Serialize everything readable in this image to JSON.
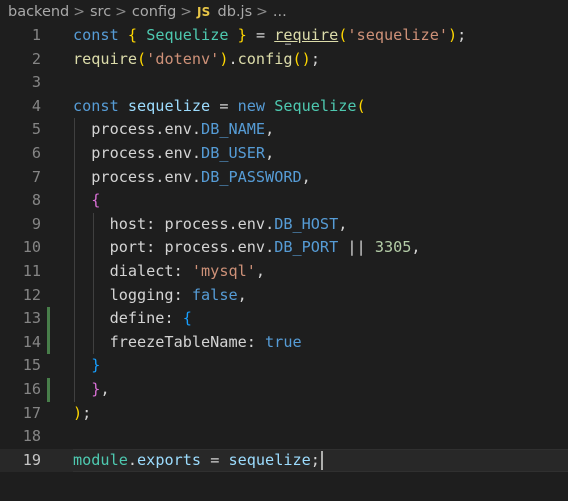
{
  "breadcrumb": {
    "segments": [
      "backend",
      "src",
      "config"
    ],
    "file_badge": "JS",
    "file_name": "db.js",
    "ellipsis": "...",
    "separator": ">"
  },
  "editor": {
    "current_line": 19,
    "lines": [
      {
        "number": "1",
        "tokens": [
          {
            "t": "const",
            "c": "kw"
          },
          {
            "t": " ",
            "c": "txt"
          },
          {
            "t": "{",
            "c": "b1"
          },
          {
            "t": " ",
            "c": "txt"
          },
          {
            "t": "Sequelize",
            "c": "cls"
          },
          {
            "t": " ",
            "c": "txt"
          },
          {
            "t": "}",
            "c": "b1"
          },
          {
            "t": " = ",
            "c": "txt"
          },
          {
            "t": "require",
            "c": "fn"
          },
          {
            "t": "(",
            "c": "b1"
          },
          {
            "t": "'sequelize'",
            "c": "str"
          },
          {
            "t": ")",
            "c": "b1"
          },
          {
            "t": ";",
            "c": "txt"
          }
        ]
      },
      {
        "number": "2",
        "tokens": [
          {
            "t": "require",
            "c": "fn"
          },
          {
            "t": "(",
            "c": "b1"
          },
          {
            "t": "'dotenv'",
            "c": "str"
          },
          {
            "t": ")",
            "c": "b1"
          },
          {
            "t": ".",
            "c": "txt"
          },
          {
            "t": "config",
            "c": "fn"
          },
          {
            "t": "()",
            "c": "b1"
          },
          {
            "t": ";",
            "c": "txt"
          }
        ]
      },
      {
        "number": "3",
        "tokens": []
      },
      {
        "number": "4",
        "tokens": [
          {
            "t": "const",
            "c": "kw"
          },
          {
            "t": " ",
            "c": "txt"
          },
          {
            "t": "sequelize",
            "c": "var"
          },
          {
            "t": " = ",
            "c": "txt"
          },
          {
            "t": "new",
            "c": "kw"
          },
          {
            "t": " ",
            "c": "txt"
          },
          {
            "t": "Sequelize",
            "c": "cls"
          },
          {
            "t": "(",
            "c": "b1"
          }
        ]
      },
      {
        "number": "5",
        "tokens": [
          {
            "t": "  process",
            "c": "txt"
          },
          {
            "t": ".",
            "c": "txt"
          },
          {
            "t": "env",
            "c": "txt"
          },
          {
            "t": ".",
            "c": "txt"
          },
          {
            "t": "DB_NAME",
            "c": "kw"
          },
          {
            "t": ",",
            "c": "txt"
          }
        ]
      },
      {
        "number": "6",
        "tokens": [
          {
            "t": "  process",
            "c": "txt"
          },
          {
            "t": ".",
            "c": "txt"
          },
          {
            "t": "env",
            "c": "txt"
          },
          {
            "t": ".",
            "c": "txt"
          },
          {
            "t": "DB_USER",
            "c": "kw"
          },
          {
            "t": ",",
            "c": "txt"
          }
        ]
      },
      {
        "number": "7",
        "tokens": [
          {
            "t": "  process",
            "c": "txt"
          },
          {
            "t": ".",
            "c": "txt"
          },
          {
            "t": "env",
            "c": "txt"
          },
          {
            "t": ".",
            "c": "txt"
          },
          {
            "t": "DB_PASSWORD",
            "c": "kw"
          },
          {
            "t": ",",
            "c": "txt"
          }
        ]
      },
      {
        "number": "8",
        "tokens": [
          {
            "t": "  ",
            "c": "txt"
          },
          {
            "t": "{",
            "c": "b2"
          }
        ]
      },
      {
        "number": "9",
        "tokens": [
          {
            "t": "    host",
            "c": "txt"
          },
          {
            "t": ": ",
            "c": "txt"
          },
          {
            "t": "process",
            "c": "txt"
          },
          {
            "t": ".",
            "c": "txt"
          },
          {
            "t": "env",
            "c": "txt"
          },
          {
            "t": ".",
            "c": "txt"
          },
          {
            "t": "DB_HOST",
            "c": "kw"
          },
          {
            "t": ",",
            "c": "txt"
          }
        ]
      },
      {
        "number": "10",
        "tokens": [
          {
            "t": "    port",
            "c": "txt"
          },
          {
            "t": ": ",
            "c": "txt"
          },
          {
            "t": "process",
            "c": "txt"
          },
          {
            "t": ".",
            "c": "txt"
          },
          {
            "t": "env",
            "c": "txt"
          },
          {
            "t": ".",
            "c": "txt"
          },
          {
            "t": "DB_PORT",
            "c": "kw"
          },
          {
            "t": " || ",
            "c": "txt"
          },
          {
            "t": "3305",
            "c": "num"
          },
          {
            "t": ",",
            "c": "txt"
          }
        ]
      },
      {
        "number": "11",
        "tokens": [
          {
            "t": "    dialect",
            "c": "txt"
          },
          {
            "t": ": ",
            "c": "txt"
          },
          {
            "t": "'mysql'",
            "c": "str"
          },
          {
            "t": ",",
            "c": "txt"
          }
        ]
      },
      {
        "number": "12",
        "tokens": [
          {
            "t": "    logging",
            "c": "txt"
          },
          {
            "t": ": ",
            "c": "txt"
          },
          {
            "t": "false",
            "c": "kw"
          },
          {
            "t": ",",
            "c": "txt"
          }
        ]
      },
      {
        "number": "13",
        "tokens": [
          {
            "t": "    define",
            "c": "txt"
          },
          {
            "t": ": ",
            "c": "txt"
          },
          {
            "t": "{",
            "c": "b3"
          }
        ]
      },
      {
        "number": "14",
        "tokens": [
          {
            "t": "    freezeTableName",
            "c": "txt"
          },
          {
            "t": ": ",
            "c": "txt"
          },
          {
            "t": "true",
            "c": "kw"
          }
        ]
      },
      {
        "number": "15",
        "tokens": [
          {
            "t": "  ",
            "c": "txt"
          },
          {
            "t": "}",
            "c": "b3"
          }
        ]
      },
      {
        "number": "16",
        "tokens": [
          {
            "t": "  ",
            "c": "txt"
          },
          {
            "t": "}",
            "c": "b2"
          },
          {
            "t": ",",
            "c": "txt"
          }
        ]
      },
      {
        "number": "17",
        "tokens": [
          {
            "t": ")",
            "c": "b1"
          },
          {
            "t": ";",
            "c": "txt"
          }
        ]
      },
      {
        "number": "18",
        "tokens": []
      },
      {
        "number": "19",
        "tokens": [
          {
            "t": "module",
            "c": "cls"
          },
          {
            "t": ".",
            "c": "txt"
          },
          {
            "t": "exports",
            "c": "var"
          },
          {
            "t": " = ",
            "c": "txt"
          },
          {
            "t": "sequelize",
            "c": "var"
          },
          {
            "t": ";",
            "c": "txt"
          }
        ]
      }
    ],
    "modified_lines": [
      "13",
      "14",
      "16"
    ],
    "guide_lines_l1": [
      "5",
      "6",
      "7",
      "8",
      "9",
      "10",
      "11",
      "12",
      "13",
      "14",
      "15",
      "16"
    ],
    "guide_lines_l2": [
      "9",
      "10",
      "11",
      "12",
      "13",
      "14"
    ]
  },
  "colors": {
    "background": "#1e1e1e",
    "keyword": "#569cd6",
    "class": "#4ec9b0",
    "function": "#dcdcaa",
    "string": "#ce9178",
    "number": "#b5cea8",
    "git_modified": "#487e4a"
  }
}
